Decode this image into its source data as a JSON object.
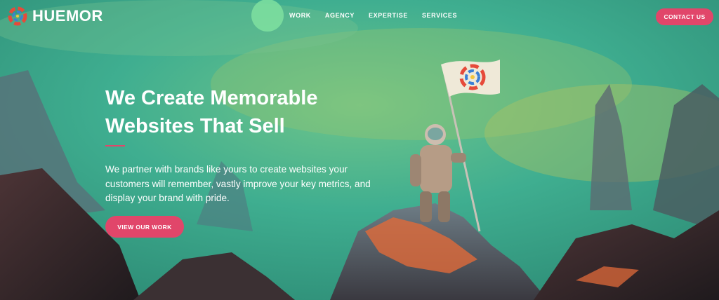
{
  "brand": {
    "name": "HUEMOR",
    "accent": "#e1466a"
  },
  "nav": {
    "items": [
      "WORK",
      "AGENCY",
      "EXPERTISE",
      "SERVICES"
    ]
  },
  "contact": {
    "label": "CONTACT US"
  },
  "hero": {
    "title": "We Create Memorable Websites That Sell",
    "description": "We partner with brands like yours to create websites your customers will remember, vastly improve your key metrics, and display your brand with pride.",
    "cta": "VIEW OUR WORK"
  },
  "icons": [
    "huemor-logo-icon",
    "flag-logo-icon"
  ]
}
